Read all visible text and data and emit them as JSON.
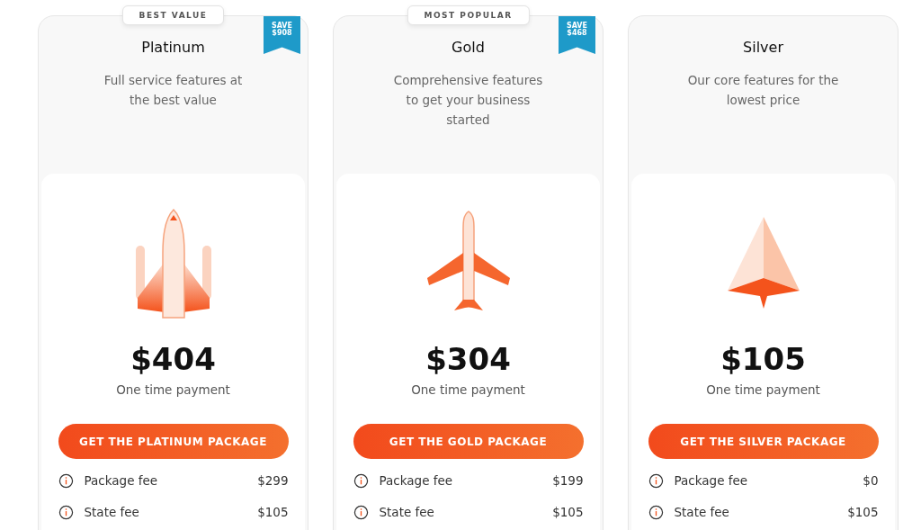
{
  "plans": [
    {
      "name": "Platinum",
      "badge": "BEST VALUE",
      "ribbon": "SAVE $908",
      "description": "Full service features at the best value",
      "kind": "shuttle",
      "price": "$404",
      "price_note": "One time payment",
      "button": "GET THE PLATINUM PACKAGE",
      "fees": [
        {
          "label": "Package fee",
          "amount": "$299"
        },
        {
          "label": "State fee",
          "amount": "$105"
        }
      ]
    },
    {
      "name": "Gold",
      "badge": "MOST POPULAR",
      "ribbon": "SAVE $468",
      "description": "Comprehensive features to get your business started",
      "kind": "plane",
      "price": "$304",
      "price_note": "One time payment",
      "button": "GET THE GOLD PACKAGE",
      "fees": [
        {
          "label": "Package fee",
          "amount": "$199"
        },
        {
          "label": "State fee",
          "amount": "$105"
        }
      ]
    },
    {
      "name": "Silver",
      "description": "Our core features for the lowest price",
      "kind": "paper-plane",
      "price": "$105",
      "price_note": "One time payment",
      "button": "GET THE SILVER PACKAGE",
      "fees": [
        {
          "label": "Package fee",
          "amount": "$0"
        },
        {
          "label": "State fee",
          "amount": "$105"
        }
      ]
    }
  ]
}
